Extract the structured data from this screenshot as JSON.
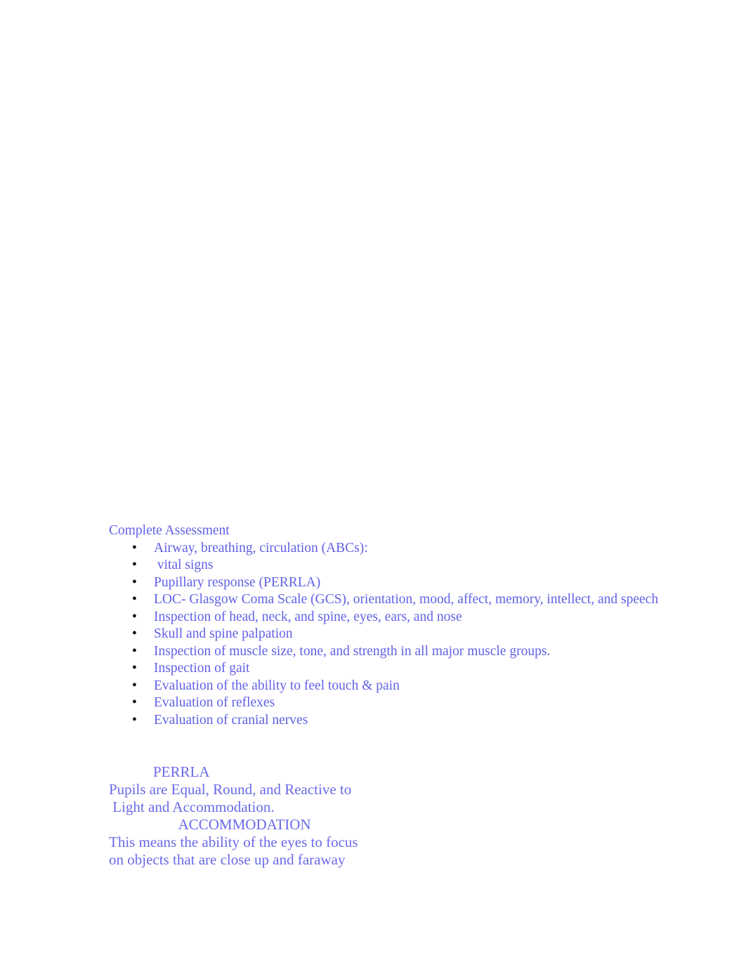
{
  "document": {
    "section_heading": "Complete Assessment",
    "text_color": "#6161E6",
    "bullet_color": "#000000",
    "bullet_glyph": "•",
    "assessment_items": [
      "Airway, breathing, circulation (ABCs):",
      " vital signs",
      "Pupillary response (PERRLA)",
      "LOC- Glasgow Coma Scale (GCS), orientation, mood, affect, memory, intellect, and speech",
      "Inspection of head, neck, and spine, eyes, ears, and nose",
      "Skull and spine palpation",
      "Inspection of muscle size, tone, and strength in all major muscle groups.",
      "Inspection of gait",
      "Evaluation of the ability to feel touch & pain",
      "Evaluation of reflexes",
      "Evaluation of cranial nerves"
    ],
    "perrla": {
      "heading": "            PERRLA",
      "line1": "Pupils are Equal, Round, and Reactive to",
      "line2": " Light and Accommodation.",
      "accommodation_heading": "                   ACCOMMODATION",
      "line3": "This means the ability of the eyes to focus",
      "line4": "on objects that are close up and faraway",
      "text_color": "#6A6AE8"
    }
  }
}
